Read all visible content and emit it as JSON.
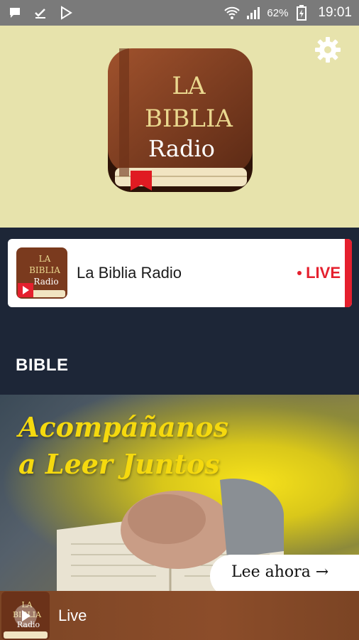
{
  "status_bar": {
    "battery": "62%",
    "time": "19:01",
    "icons": [
      "chat-notification-icon",
      "download-done-icon",
      "play-store-icon",
      "wifi-icon",
      "signal-icon",
      "battery-charging-icon"
    ]
  },
  "header": {
    "logo_lines": [
      "LA",
      "BIBLIA",
      "Radio"
    ],
    "settings_icon": "gear-icon"
  },
  "live_station": {
    "title": "La Biblia Radio",
    "badge": "LIVE",
    "thumb_lines": [
      "LA",
      "BIBLIA",
      "Radio"
    ]
  },
  "section": {
    "title": "BIBLE"
  },
  "banner": {
    "headline_line1": "Acompáñanos",
    "headline_line2": "a Leer Juntos",
    "cta": "Lee ahora →"
  },
  "mini_player": {
    "label": "Live",
    "thumb_lines": [
      "LA",
      "BIBLIA",
      "Radio"
    ]
  },
  "colors": {
    "header_bg": "#e7e3ac",
    "page_bg": "#1d2637",
    "live_red": "#e5202e",
    "banner_yellow": "#f5d90e",
    "player_brown": "#8c4d2a"
  }
}
